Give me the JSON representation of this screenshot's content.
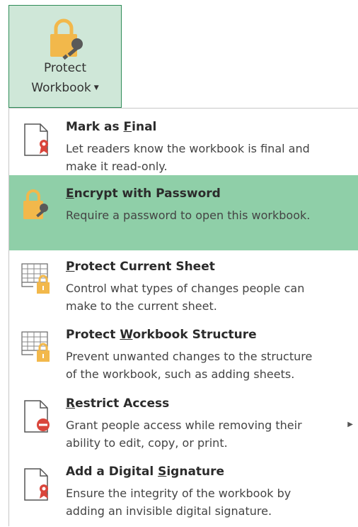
{
  "ribbon": {
    "protect_workbook_line1": "Protect",
    "protect_workbook_line2": "Workbook"
  },
  "menu": {
    "items": [
      {
        "title_pre": "Mark as ",
        "title_key": "F",
        "title_post": "inal",
        "desc_line1": "Let readers know the workbook is final and",
        "desc_line2": "make it read-only."
      },
      {
        "title_pre": "",
        "title_key": "E",
        "title_post": "ncrypt with Password",
        "desc_line1": "Require a password to open this workbook."
      },
      {
        "title_pre": "",
        "title_key": "P",
        "title_post": "rotect Current Sheet",
        "desc_line1": "Control what types of changes people can",
        "desc_line2": "make to the current sheet."
      },
      {
        "title_pre": "Protect ",
        "title_key": "W",
        "title_post": "orkbook Structure",
        "desc_line1": "Prevent unwanted changes to the structure",
        "desc_line2": "of the workbook, such as adding sheets."
      },
      {
        "title_pre": "",
        "title_key": "R",
        "title_post": "estrict Access",
        "desc_line1": "Grant people access while removing their",
        "desc_line2": "ability to edit, copy, or print."
      },
      {
        "title_pre": "Add a Digital ",
        "title_key": "S",
        "title_post": "ignature",
        "desc_line1": "Ensure the integrity of the workbook by",
        "desc_line2": "adding an invisible digital signature."
      }
    ]
  },
  "colors": {
    "highlight": "#8fcfa8",
    "ribbon_bg": "#cfe7d8",
    "lock": "#f2b84b",
    "ribbon_red": "#d9453b"
  }
}
